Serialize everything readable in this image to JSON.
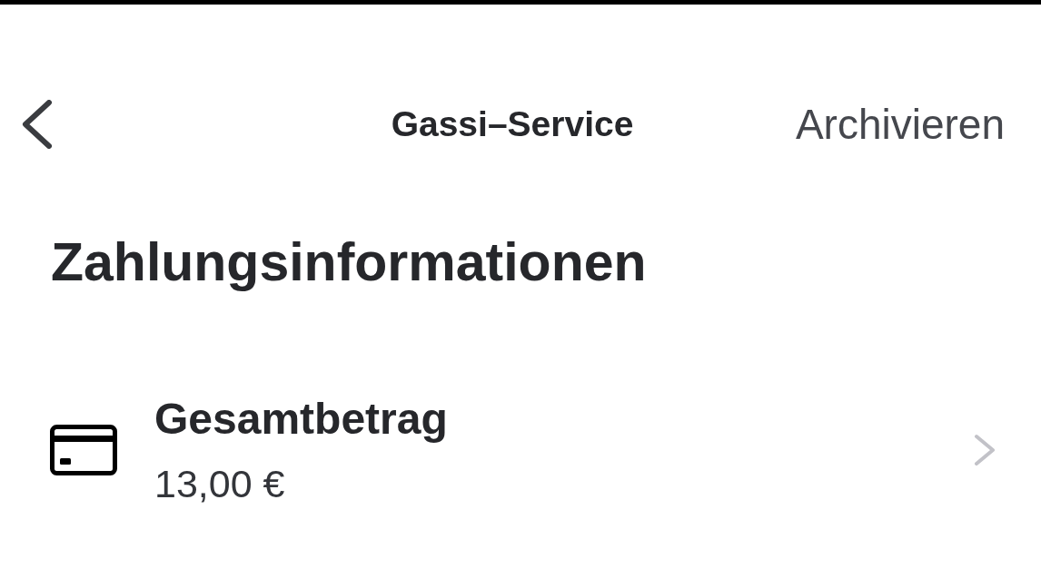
{
  "nav": {
    "title": "Gassi–Service",
    "action": "Archivieren"
  },
  "section": {
    "heading": "Zahlungsinformationen",
    "items": [
      {
        "kind": "payment",
        "label": "Gesamtbetrag",
        "value": "13,00 €"
      }
    ]
  }
}
